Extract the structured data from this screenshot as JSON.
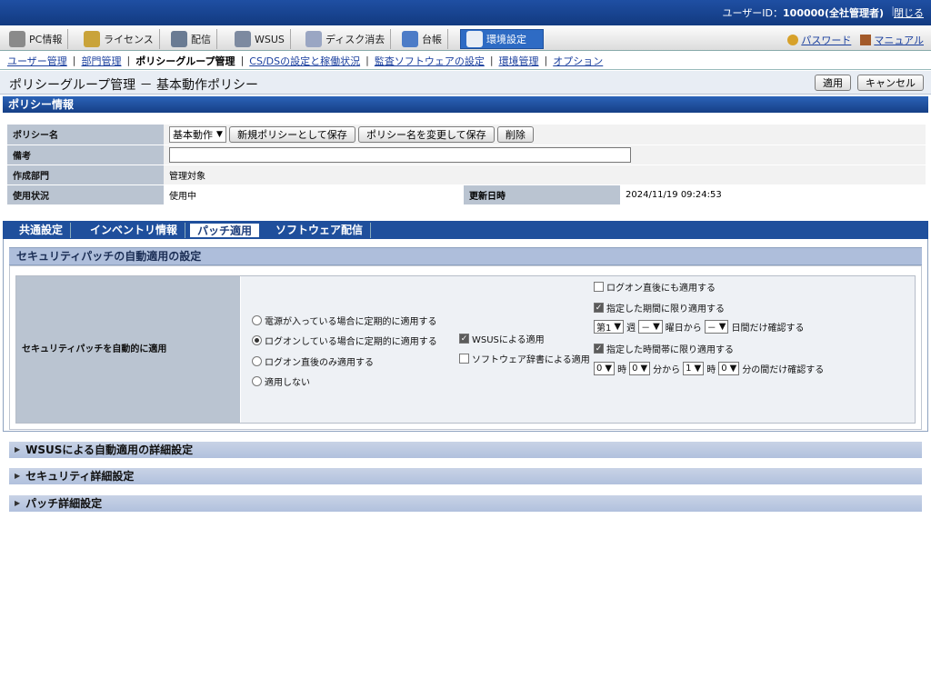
{
  "topbar": {
    "user_label": "ユーザーID：",
    "user_value": "100000(全社管理者)",
    "separator": "|",
    "close": "閉じる"
  },
  "tabs": [
    {
      "label": "PC情報",
      "icon": "pc-icon",
      "color": "#8a8a8a"
    },
    {
      "label": "ライセンス",
      "icon": "license-icon",
      "color": "#c9a33a"
    },
    {
      "label": "配信",
      "icon": "delivery-icon",
      "color": "#6a7b93"
    },
    {
      "label": "WSUS",
      "icon": "wsus-icon",
      "color": "#7d8aa0"
    },
    {
      "label": "ディスク消去",
      "icon": "disk-erase-icon",
      "color": "#9aa6c3"
    },
    {
      "label": "台帳",
      "icon": "ledger-icon",
      "color": "#4d7cc7"
    },
    {
      "label": "環境設定",
      "icon": "settings-icon",
      "color": "#e8edf5"
    }
  ],
  "tabs_right": {
    "password": "パスワード",
    "manual": "マニュアル"
  },
  "subnav": [
    {
      "label": "ユーザー管理",
      "current": false
    },
    {
      "label": "部門管理",
      "current": false
    },
    {
      "label": "ポリシーグループ管理",
      "current": true
    },
    {
      "label": "CS/DSの設定と稼働状況",
      "current": false
    },
    {
      "label": "監査ソフトウェアの設定",
      "current": false
    },
    {
      "label": "環境管理",
      "current": false
    },
    {
      "label": "オプション",
      "current": false
    }
  ],
  "page": {
    "title": "ポリシーグループ管理 － 基本動作ポリシー",
    "apply": "適用",
    "cancel": "キャンセル"
  },
  "policy_info": {
    "heading": "ポリシー情報",
    "name_label": "ポリシー名",
    "name_value": "基本動作",
    "btn_save_new": "新規ポリシーとして保存",
    "btn_rename": "ポリシー名を変更して保存",
    "btn_delete": "削除",
    "memo_label": "備考",
    "dept_label": "作成部門",
    "dept_value": "管理対象",
    "status_label": "使用状況",
    "status_value": "使用中",
    "updated_label": "更新日時",
    "updated_value": "2024/11/19 09:24:53"
  },
  "subtabs": [
    {
      "label": "共通設定",
      "active": false
    },
    {
      "label": "インベントリ情報",
      "active": false
    },
    {
      "label": "パッチ適用",
      "active": true
    },
    {
      "label": "ソフトウェア配信",
      "active": false
    }
  ],
  "security": {
    "heading": "セキュリティパッチの自動適用の設定",
    "row_label": "セキュリティパッチを自動的に適用",
    "radios": [
      {
        "label": "電源が入っている場合に定期的に適用する",
        "checked": false
      },
      {
        "label": "ログオンしている場合に定期的に適用する",
        "checked": true
      },
      {
        "label": "ログオン直後のみ適用する",
        "checked": false
      },
      {
        "label": "適用しない",
        "checked": false
      }
    ],
    "wsus": {
      "label": "WSUSによる適用",
      "checked": true
    },
    "swdict": {
      "label": "ソフトウェア辞書による適用",
      "checked": false
    },
    "logon_also": {
      "label": "ログオン直後にも適用する",
      "checked": false
    },
    "period_limit": {
      "label": "指定した期間に限り適用する",
      "checked": true
    },
    "period_row": {
      "week": "第1",
      "week_suffix": "週",
      "day": "－",
      "day_suffix": "曜日から",
      "days": "－",
      "days_suffix": "日間だけ確認する"
    },
    "time_limit": {
      "label": "指定した時間帯に限り適用する",
      "checked": true
    },
    "time_row": {
      "h1": "0",
      "h1_suffix": "時",
      "m1": "0",
      "m1_suffix": "分から",
      "h2": "1",
      "h2_suffix": "時",
      "m2": "0",
      "m2_suffix": "分の間だけ確認する"
    }
  },
  "collapsed_sections": [
    {
      "label": "WSUSによる自動適用の詳細設定"
    },
    {
      "label": "セキュリティ詳細設定"
    },
    {
      "label": "パッチ詳細設定"
    }
  ]
}
